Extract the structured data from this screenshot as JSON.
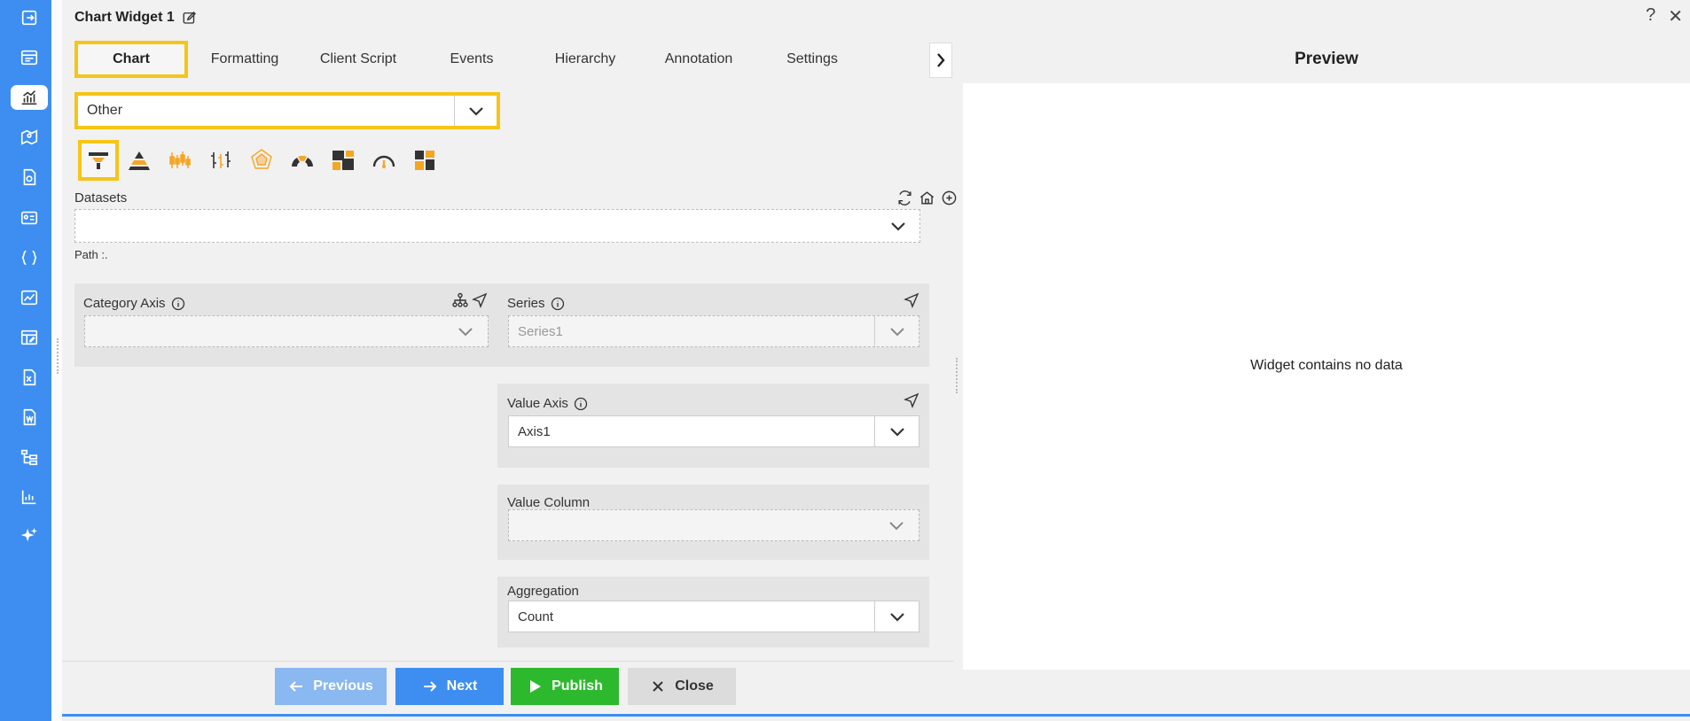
{
  "window": {
    "title": "Chart Widget 1",
    "help": "?",
    "close": "✕"
  },
  "tabs": [
    {
      "label": "Chart"
    },
    {
      "label": "Formatting"
    },
    {
      "label": "Client Script"
    },
    {
      "label": "Events"
    },
    {
      "label": "Hierarchy"
    },
    {
      "label": "Annotation"
    },
    {
      "label": "Settings"
    }
  ],
  "chart_type": {
    "value": "Other"
  },
  "datasets": {
    "label": "Datasets",
    "value": "",
    "path": "Path :."
  },
  "category_axis": {
    "label": "Category Axis",
    "value": ""
  },
  "series": {
    "label": "Series",
    "value": "Series1"
  },
  "value_axis": {
    "label": "Value Axis",
    "value": "Axis1"
  },
  "value_column": {
    "label": "Value Column",
    "value": ""
  },
  "aggregation": {
    "label": "Aggregation",
    "value": "Count"
  },
  "footer": {
    "previous": "Previous",
    "next": "Next",
    "publish": "Publish",
    "close": "Close"
  },
  "preview": {
    "title": "Preview",
    "empty": "Widget contains no data"
  },
  "colors": {
    "accent": "#3d8ef0",
    "highlight": "#f5c518",
    "publish": "#2db92d",
    "orange": "#f5a623"
  }
}
